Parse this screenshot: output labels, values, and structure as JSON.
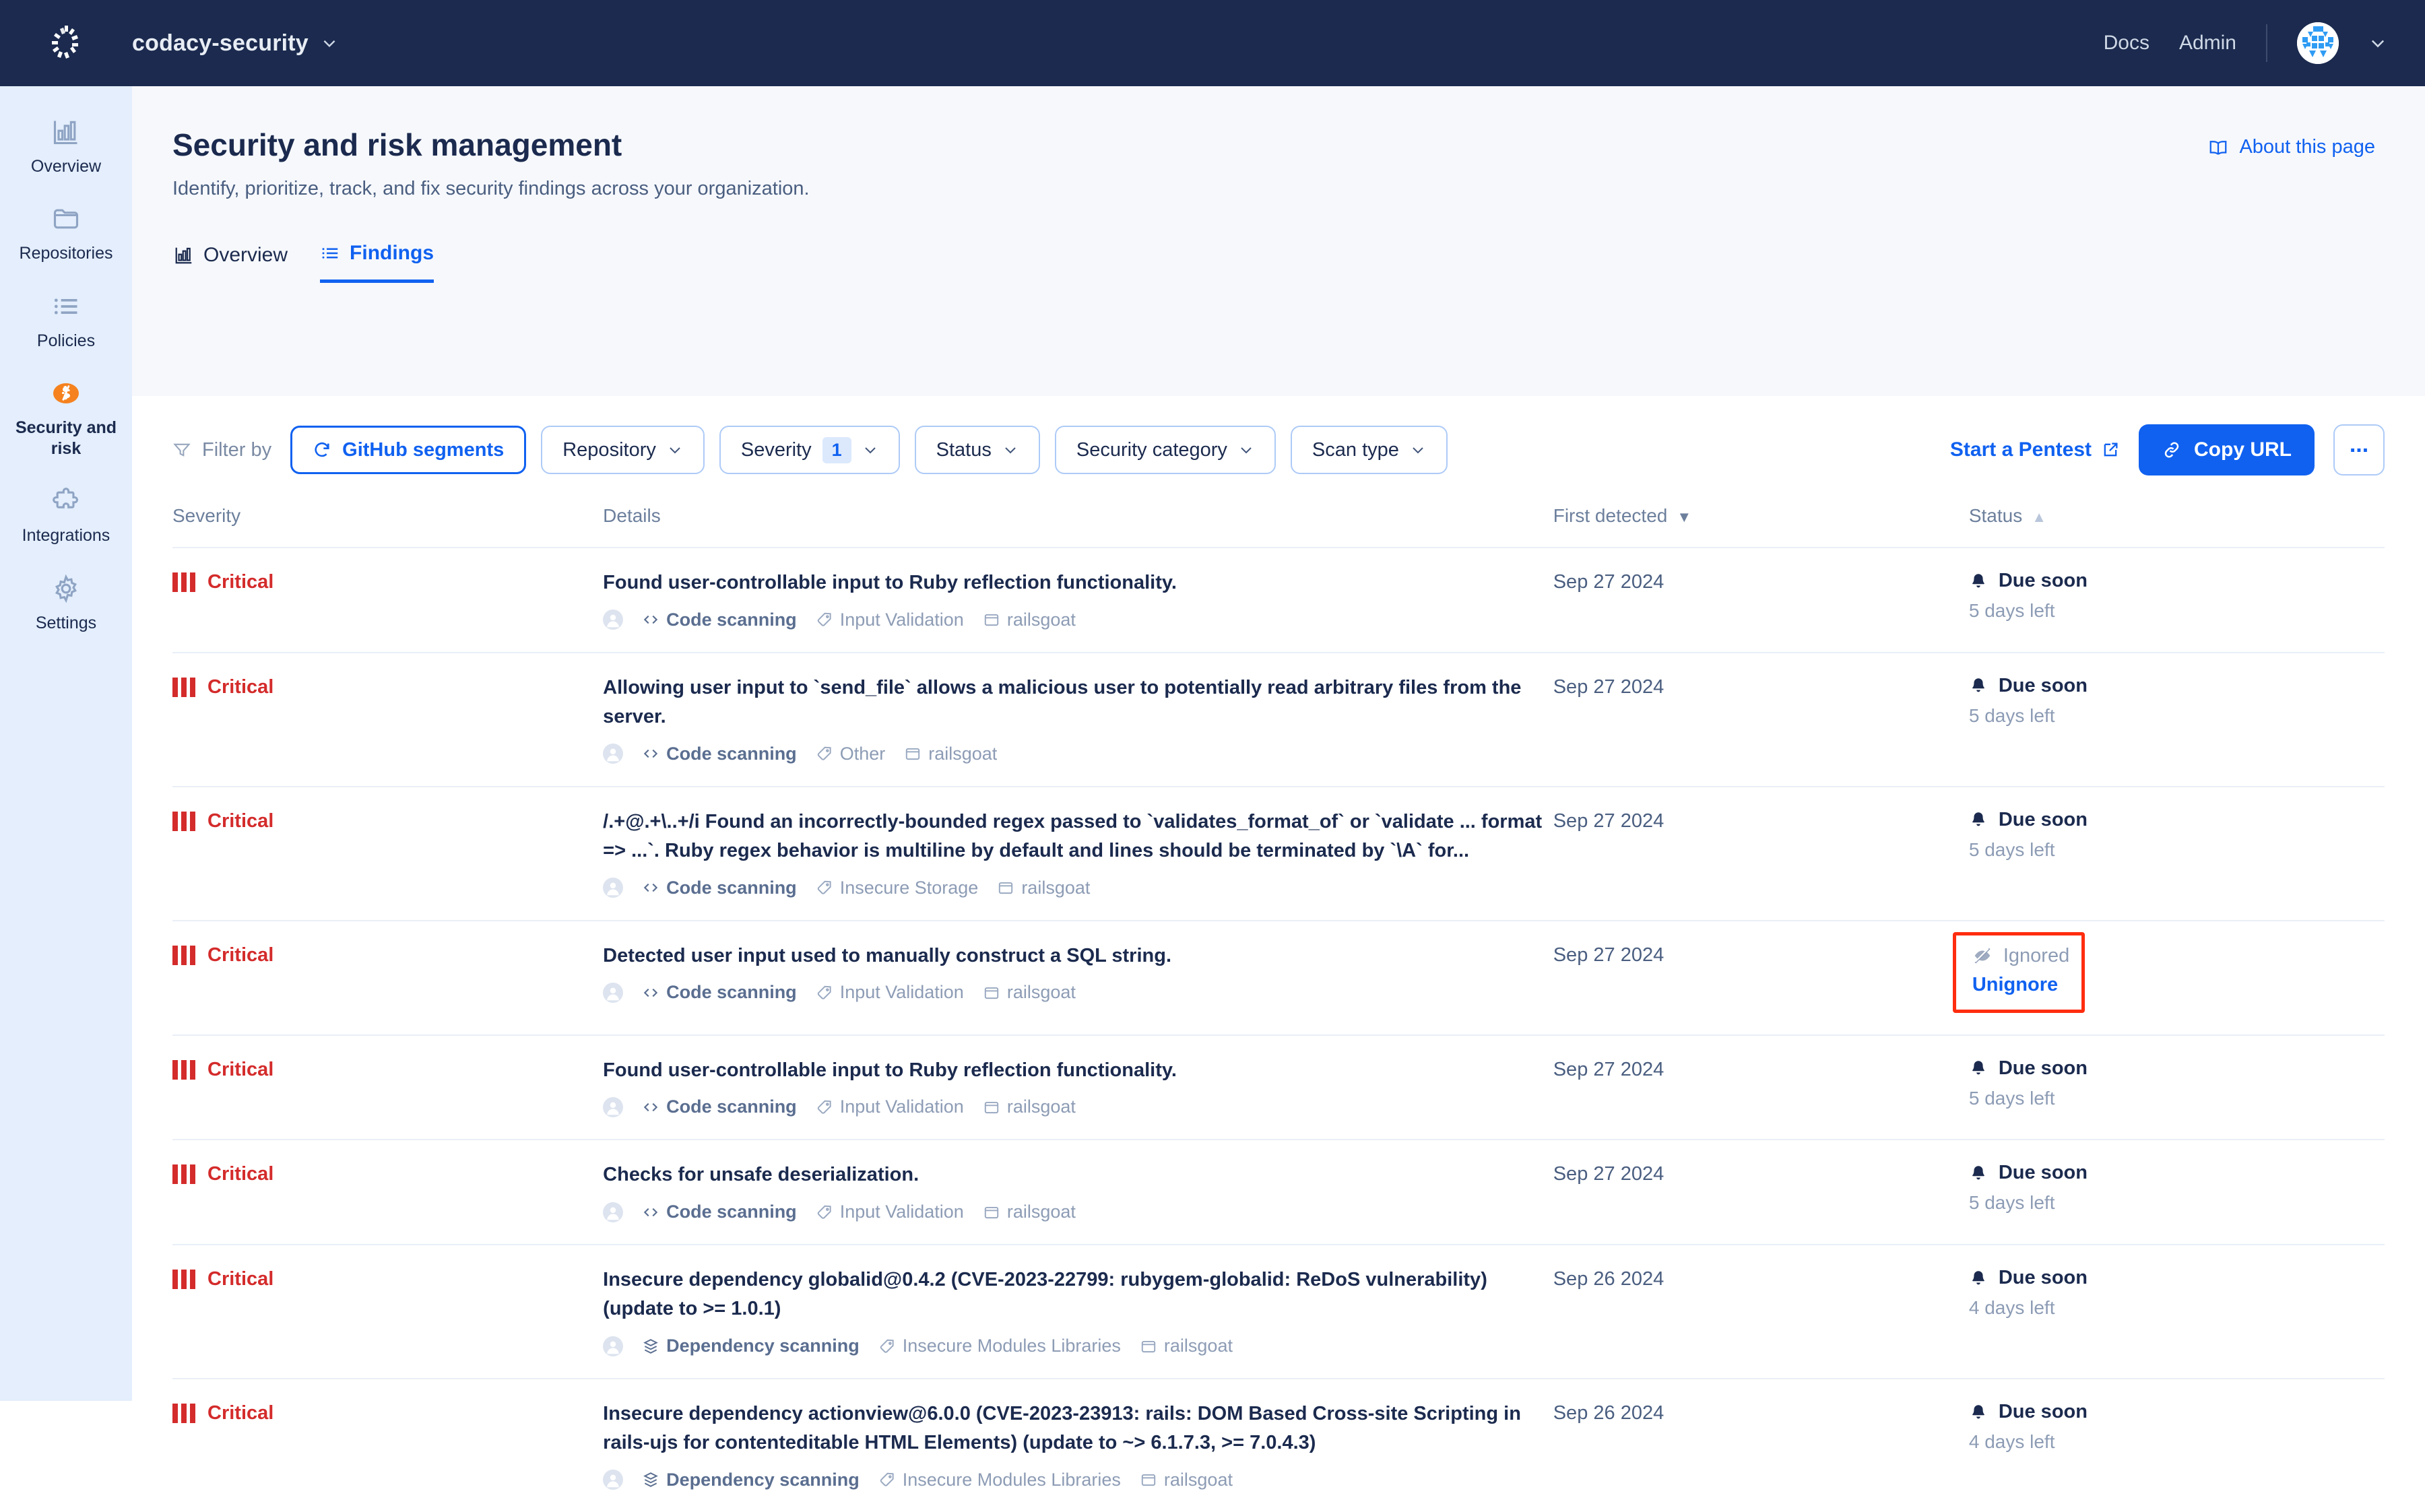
{
  "topbar": {
    "org_name": "codacy-security",
    "links": [
      "Docs",
      "Admin"
    ],
    "logo_name": "codacy-logo",
    "avatar_name": "user-avatar"
  },
  "sidebar": {
    "items": [
      {
        "label": "Overview",
        "icon": "bar-chart-icon",
        "active": false
      },
      {
        "label": "Repositories",
        "icon": "folder-icon",
        "active": false
      },
      {
        "label": "Policies",
        "icon": "list-icon",
        "active": false
      },
      {
        "label": "Security and risk",
        "icon": "security-shield-icon",
        "active": true
      },
      {
        "label": "Integrations",
        "icon": "puzzle-icon",
        "active": false
      },
      {
        "label": "Settings",
        "icon": "gear-icon",
        "active": false
      }
    ]
  },
  "page": {
    "title": "Security and risk management",
    "subtitle": "Identify, prioritize, track, and fix security findings across your organization.",
    "about_label": "About this page"
  },
  "tabs": [
    {
      "label": "Overview",
      "icon": "bar-chart-icon",
      "active": false
    },
    {
      "label": "Findings",
      "icon": "list-icon",
      "active": true
    }
  ],
  "toolbar": {
    "filter_by_label": "Filter by",
    "chips": [
      {
        "label": "GitHub segments",
        "primary": true,
        "icon": "refresh-icon",
        "badge": "",
        "caret": false
      },
      {
        "label": "Repository",
        "primary": false,
        "icon": "",
        "badge": "",
        "caret": true
      },
      {
        "label": "Severity",
        "primary": false,
        "icon": "",
        "badge": "1",
        "caret": true
      },
      {
        "label": "Status",
        "primary": false,
        "icon": "",
        "badge": "",
        "caret": true
      },
      {
        "label": "Security category",
        "primary": false,
        "icon": "",
        "badge": "",
        "caret": true
      },
      {
        "label": "Scan type",
        "primary": false,
        "icon": "",
        "badge": "",
        "caret": true
      }
    ],
    "pentest_label": "Start a Pentest",
    "copy_url_label": "Copy URL",
    "more_label": "..."
  },
  "table": {
    "columns": [
      {
        "label": "Severity",
        "sorted": false,
        "sort_dir": ""
      },
      {
        "label": "Details",
        "sorted": false,
        "sort_dir": ""
      },
      {
        "label": "First detected",
        "sorted": true,
        "sort_dir": "▼"
      },
      {
        "label": "Status",
        "sorted": false,
        "sort_dir": "▲"
      }
    ],
    "rows": [
      {
        "severity": "Critical",
        "title": "Found user-controllable input to Ruby reflection functionality.",
        "scan_type": "Code scanning",
        "scan_icon": "code-brackets-icon",
        "category": "Input Validation",
        "repository": "railsgoat",
        "date": "Sep 27 2024",
        "status_kind": "due",
        "status_label": "Due soon",
        "status_sub": "5 days left",
        "highlighted": false
      },
      {
        "severity": "Critical",
        "title": "Allowing user input to `send_file` allows a malicious user to potentially read arbitrary files from the server.",
        "scan_type": "Code scanning",
        "scan_icon": "code-brackets-icon",
        "category": "Other",
        "repository": "railsgoat",
        "date": "Sep 27 2024",
        "status_kind": "due",
        "status_label": "Due soon",
        "status_sub": "5 days left",
        "highlighted": false
      },
      {
        "severity": "Critical",
        "title": "/.+@.+\\..+/i Found an incorrectly-bounded regex passed to `validates_format_of` or `validate ... format => ...`. Ruby regex behavior is multiline by default and lines should be terminated by `\\A` for...",
        "scan_type": "Code scanning",
        "scan_icon": "code-brackets-icon",
        "category": "Insecure Storage",
        "repository": "railsgoat",
        "date": "Sep 27 2024",
        "status_kind": "due",
        "status_label": "Due soon",
        "status_sub": "5 days left",
        "highlighted": false
      },
      {
        "severity": "Critical",
        "title": "Detected user input used to manually construct a SQL string.",
        "scan_type": "Code scanning",
        "scan_icon": "code-brackets-icon",
        "category": "Input Validation",
        "repository": "railsgoat",
        "date": "Sep 27 2024",
        "status_kind": "ignored",
        "status_label": "Ignored",
        "status_sub": "Unignore",
        "highlighted": true
      },
      {
        "severity": "Critical",
        "title": "Found user-controllable input to Ruby reflection functionality.",
        "scan_type": "Code scanning",
        "scan_icon": "code-brackets-icon",
        "category": "Input Validation",
        "repository": "railsgoat",
        "date": "Sep 27 2024",
        "status_kind": "due",
        "status_label": "Due soon",
        "status_sub": "5 days left",
        "highlighted": false
      },
      {
        "severity": "Critical",
        "title": "Checks for unsafe deserialization.",
        "scan_type": "Code scanning",
        "scan_icon": "code-brackets-icon",
        "category": "Input Validation",
        "repository": "railsgoat",
        "date": "Sep 27 2024",
        "status_kind": "due",
        "status_label": "Due soon",
        "status_sub": "5 days left",
        "highlighted": false
      },
      {
        "severity": "Critical",
        "title": "Insecure dependency globalid@0.4.2 (CVE-2023-22799: rubygem-globalid: ReDoS vulnerability) (update to >= 1.0.1)",
        "scan_type": "Dependency scanning",
        "scan_icon": "layers-icon",
        "category": "Insecure Modules Libraries",
        "repository": "railsgoat",
        "date": "Sep 26 2024",
        "status_kind": "due",
        "status_label": "Due soon",
        "status_sub": "4 days left",
        "highlighted": false
      },
      {
        "severity": "Critical",
        "title": "Insecure dependency actionview@6.0.0 (CVE-2023-23913: rails: DOM Based Cross-site Scripting in rails-ujs for contenteditable HTML Elements) (update to ~> 6.1.7.3, >= 7.0.4.3)",
        "scan_type": "Dependency scanning",
        "scan_icon": "layers-icon",
        "category": "Insecure Modules Libraries",
        "repository": "railsgoat",
        "date": "Sep 26 2024",
        "status_kind": "due",
        "status_label": "Due soon",
        "status_sub": "4 days left",
        "highlighted": false
      }
    ]
  },
  "colors": {
    "brand_navy": "#1b2a4e",
    "accent_blue": "#1061f0",
    "critical_red": "#d42b2b",
    "highlight_red": "#ff2d0f",
    "sidebar_bg": "#e4eefc",
    "security_orange": "#f5821f"
  }
}
